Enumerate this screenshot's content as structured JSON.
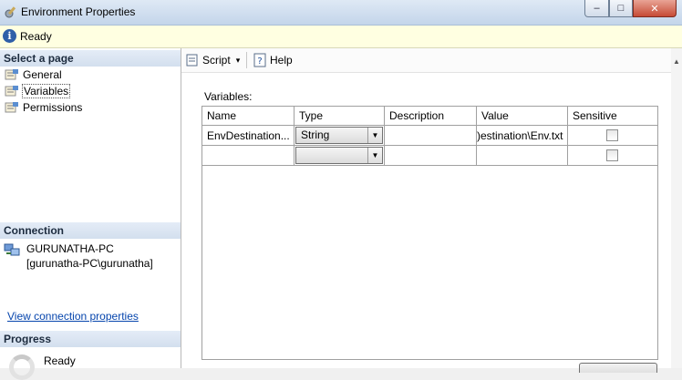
{
  "window": {
    "title": "Environment Properties",
    "buttons": {
      "minimize": "‒",
      "maximize": "□",
      "close": "✕"
    }
  },
  "status": {
    "icon": "info-icon",
    "text": "Ready"
  },
  "sidebar": {
    "select_page_header": "Select a page",
    "items": [
      {
        "label": "General",
        "icon": "properties-icon",
        "selected": false
      },
      {
        "label": "Variables",
        "icon": "properties-icon",
        "selected": true
      },
      {
        "label": "Permissions",
        "icon": "properties-icon",
        "selected": false
      }
    ],
    "connection_header": "Connection",
    "connection": {
      "server": "GURUNATHA-PC",
      "user": "[gurunatha-PC\\gurunatha]",
      "link": "View connection properties"
    },
    "progress_header": "Progress",
    "progress": {
      "status": "Ready"
    }
  },
  "toolbar": {
    "script_label": "Script",
    "script_arrow": "▾",
    "help_label": "Help"
  },
  "variables": {
    "label": "Variables:",
    "columns": [
      "Name",
      "Type",
      "Description",
      "Value",
      "Sensitive"
    ],
    "rows": [
      {
        "name": "EnvDestination...",
        "type": "String",
        "description": "",
        "value": ")estination\\Env.txt",
        "sensitive": false
      },
      {
        "name": "",
        "type": "",
        "description": "",
        "value": "",
        "sensitive": false
      }
    ]
  },
  "colors": {
    "title_bar": "#c4d5ea",
    "info_bar": "#ffffe1",
    "section_header": "#d3dfee",
    "link": "#0645ad"
  }
}
